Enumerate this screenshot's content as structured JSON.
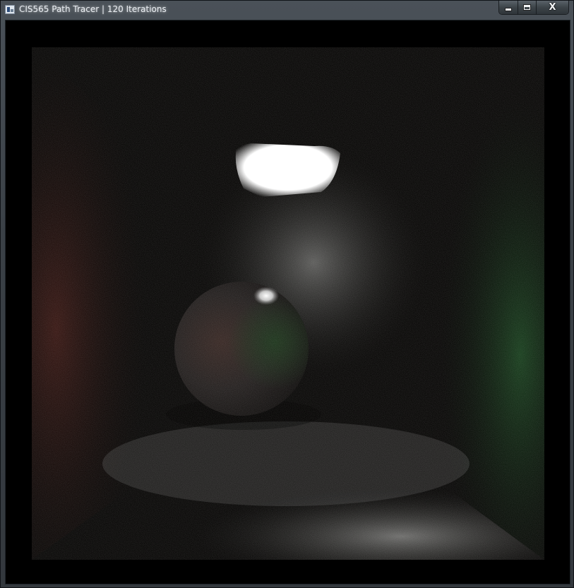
{
  "window": {
    "title": "CIS565 Path Tracer | 120 Iterations"
  },
  "caption_buttons": {
    "minimize_icon": "minimize-icon",
    "maximize_icon": "maximize-icon",
    "close_label": "X"
  },
  "render": {
    "scene": "cornell-box",
    "colors": {
      "left_wall": "#3a1a16",
      "right_wall": "#163a1c",
      "light": "#ffffff",
      "floor": "#8a8a8a"
    }
  }
}
